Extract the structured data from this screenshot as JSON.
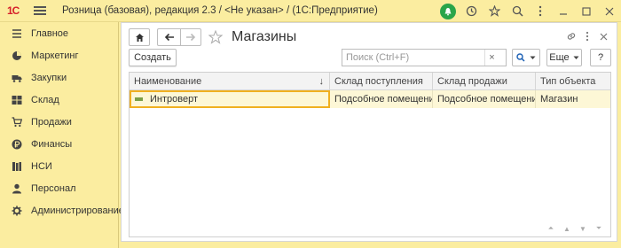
{
  "app": {
    "logo": "1С",
    "title": "Розница (базовая), редакция 2.3 / <Не указан> / (1С:Предприятие)"
  },
  "titlebar_icons": [
    "bell-icon",
    "history-icon",
    "star-icon",
    "search-icon",
    "more-icon",
    "minimize-icon",
    "maximize-icon",
    "close-icon"
  ],
  "sidebar": {
    "items": [
      {
        "label": "Главное",
        "icon": "menu-icon"
      },
      {
        "label": "Маркетинг",
        "icon": "pie-chart-icon"
      },
      {
        "label": "Закупки",
        "icon": "truck-icon"
      },
      {
        "label": "Склад",
        "icon": "warehouse-icon"
      },
      {
        "label": "Продажи",
        "icon": "cart-icon"
      },
      {
        "label": "Финансы",
        "icon": "ruble-icon"
      },
      {
        "label": "НСИ",
        "icon": "books-icon"
      },
      {
        "label": "Персонал",
        "icon": "person-icon"
      },
      {
        "label": "Администрирование",
        "icon": "gear-icon"
      }
    ]
  },
  "page": {
    "title": "Магазины",
    "create_label": "Создать",
    "search_placeholder": "Поиск (Ctrl+F)",
    "search_clear": "×",
    "more_label": "Еще",
    "help_label": "?"
  },
  "table": {
    "columns": [
      "Наименование",
      "Склад поступления",
      "Склад продажи",
      "Тип объекта"
    ],
    "sort_indicator": "↓",
    "rows": [
      [
        "Интроверт",
        "Подсобное помещение",
        "Подсобное помещение",
        "Магазин"
      ]
    ]
  },
  "colors": {
    "accent_yellow": "#fbeda0",
    "selection_border": "#f0b020",
    "row_highlight": "#fdf7d6",
    "bell_green": "#2aa54a"
  }
}
